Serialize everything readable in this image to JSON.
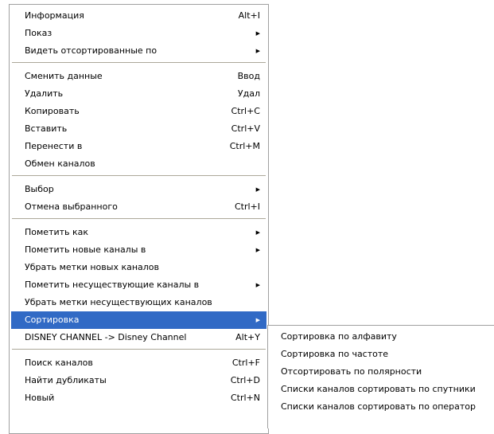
{
  "menu": {
    "groups": [
      [
        {
          "label": "Информация",
          "shortcut": "Alt+I"
        },
        {
          "label": "Показ",
          "submenu": true
        },
        {
          "label": "Видеть отсортированные по",
          "submenu": true
        }
      ],
      [
        {
          "label": "Сменить данные",
          "shortcut": "Ввод"
        },
        {
          "label": "Удалить",
          "shortcut": "Удал"
        },
        {
          "label": "Копировать",
          "shortcut": "Ctrl+C"
        },
        {
          "label": "Вставить",
          "shortcut": "Ctrl+V"
        },
        {
          "label": "Перенести в",
          "shortcut": "Ctrl+M"
        },
        {
          "label": "Обмен каналов"
        }
      ],
      [
        {
          "label": "Выбор",
          "submenu": true
        },
        {
          "label": "Отмена выбранного",
          "shortcut": "Ctrl+I"
        }
      ],
      [
        {
          "label": "Пометить как",
          "submenu": true
        },
        {
          "label": "Пометить новые каналы в",
          "submenu": true
        },
        {
          "label": "Убрать метки новых каналов"
        },
        {
          "label": "Пометить несуществующие каналы в",
          "submenu": true
        },
        {
          "label": "Убрать метки несуществующих каналов"
        },
        {
          "label": "Сортировка",
          "submenu": true,
          "selected": true
        },
        {
          "label": "DISNEY CHANNEL -> Disney Channel",
          "shortcut": "Alt+Y"
        }
      ],
      [
        {
          "label": "Поиск каналов",
          "shortcut": "Ctrl+F"
        },
        {
          "label": "Найти дубликаты",
          "shortcut": "Ctrl+D"
        },
        {
          "label": "Новый",
          "shortcut": "Ctrl+N"
        }
      ]
    ],
    "arrow_glyph": "▶"
  },
  "submenu": {
    "items": [
      {
        "label": "Сортировка по алфавиту"
      },
      {
        "label": "Сортировка по частоте"
      },
      {
        "label": "Отсортировать по полярности"
      },
      {
        "label": "Списки каналов сортировать по спутники"
      },
      {
        "label": "Списки каналов сортировать по оператор"
      }
    ]
  },
  "colors": {
    "highlight": "#316ac5",
    "highlight_text": "#ffffff",
    "separator": "#aca899",
    "border": "#a0a0a0"
  }
}
